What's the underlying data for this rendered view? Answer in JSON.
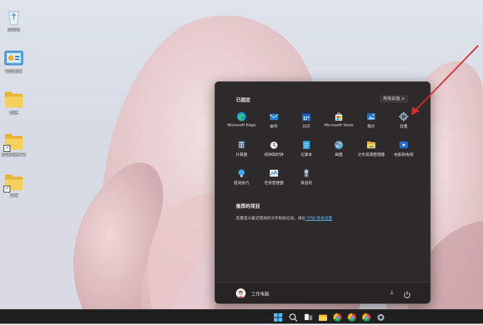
{
  "desktop": {
    "icons": [
      {
        "label": "回收站",
        "type": "recycle"
      },
      {
        "label": "控制面板",
        "type": "control"
      },
      {
        "label": "新建",
        "type": "folder"
      },
      {
        "label": "系统快捷方式",
        "type": "folder-shortcut"
      },
      {
        "label": "文档",
        "type": "folder-shortcut"
      }
    ]
  },
  "start_menu": {
    "pinned_title": "已固定",
    "all_apps": "所有应用 >",
    "apps": [
      {
        "name": "Microsoft Edge",
        "icon": "edge-icon"
      },
      {
        "name": "邮件",
        "icon": "mail-icon"
      },
      {
        "name": "日历",
        "icon": "calendar-icon"
      },
      {
        "name": "Microsoft Store",
        "icon": "store-icon"
      },
      {
        "name": "照片",
        "icon": "photos-icon"
      },
      {
        "name": "设置",
        "icon": "gear-icon"
      },
      {
        "name": "计算器",
        "icon": "calculator-icon"
      },
      {
        "name": "闹钟和时钟",
        "icon": "clock-icon"
      },
      {
        "name": "记事本",
        "icon": "notepad-icon"
      },
      {
        "name": "画图",
        "icon": "paint-icon"
      },
      {
        "name": "文件资源管理器",
        "icon": "explorer-icon"
      },
      {
        "name": "电影和电视",
        "icon": "movies-icon"
      },
      {
        "name": "使用技巧",
        "icon": "tips-icon"
      },
      {
        "name": "任务管理器",
        "icon": "taskmgr-icon"
      },
      {
        "name": "录音机",
        "icon": "recorder-icon"
      }
    ],
    "recommended_title": "推荐的项目",
    "recommended_text": "若要显示最近使用的文件和新应用，请在",
    "recommended_link": "\"开始\"菜单设置",
    "recommended_tail": "",
    "user_name": "工作电脑"
  },
  "taskbar": {
    "items": [
      "start-icon",
      "search-icon",
      "task-view-icon",
      "file-explorer-icon",
      "chrome-icon",
      "chrome-icon",
      "chrome-icon",
      "settings-icon"
    ]
  },
  "colors": {
    "accent_arrow": "#e0292a",
    "menu_bg": "#2c2a2a",
    "taskbar_bg": "#1f1f1f"
  }
}
